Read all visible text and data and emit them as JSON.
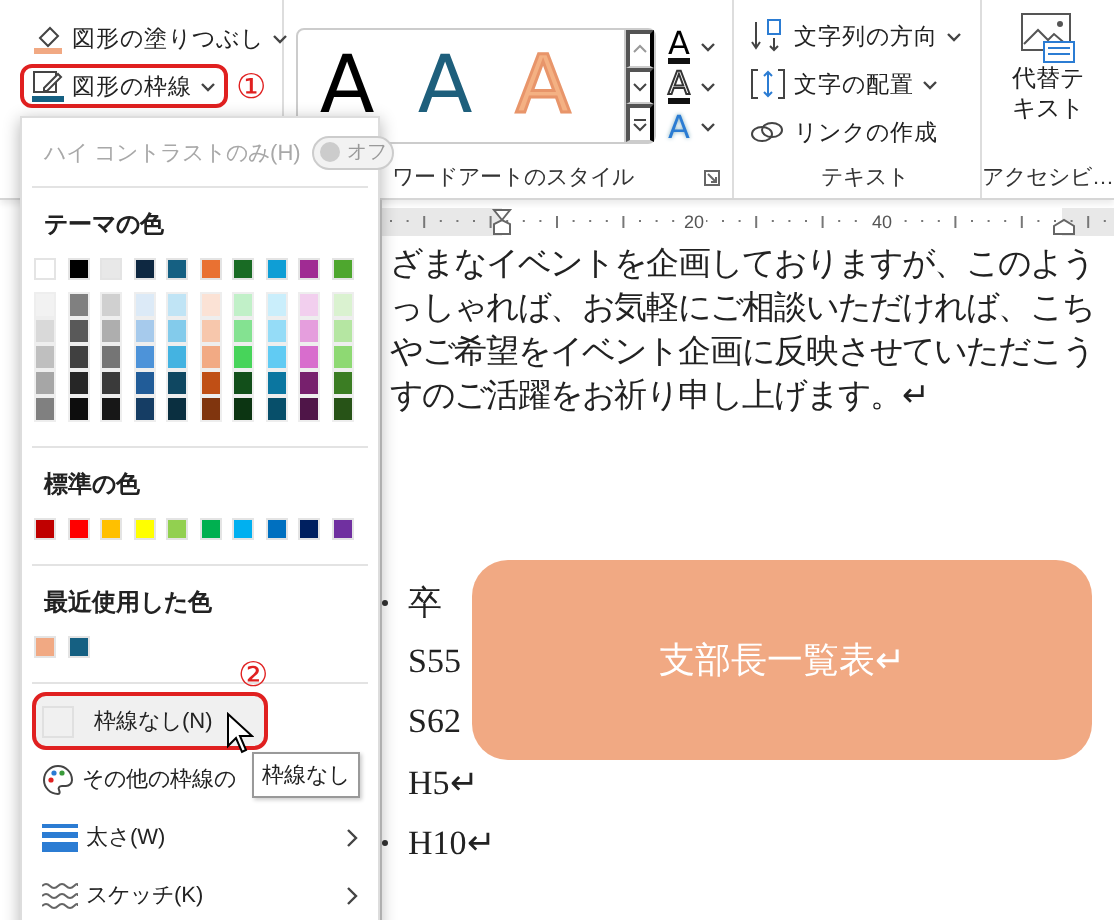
{
  "shape_group": {
    "callout": "①",
    "items": [
      {
        "label": "図形の塗りつぶし",
        "kind": "fill",
        "highlighted": false
      },
      {
        "label": "図形の枠線",
        "kind": "outline",
        "highlighted": true
      }
    ]
  },
  "wordart": {
    "label": "ワードアートのスタイル",
    "gallery": [
      {
        "glyph": "A",
        "kind": "fill",
        "color": "#000000"
      },
      {
        "glyph": "A",
        "kind": "fill",
        "color": "#1e5f7c"
      },
      {
        "glyph": "A",
        "kind": "outline",
        "color": "#f4b183"
      }
    ],
    "buttons": [
      {
        "glyph": "A",
        "kind": "fill"
      },
      {
        "glyph": "A",
        "kind": "outline"
      },
      {
        "glyph": "A",
        "kind": "effects"
      }
    ]
  },
  "text_group": {
    "label": "テキスト",
    "items": [
      {
        "label": "文字列の方向",
        "kind": "direction",
        "dropdown": true
      },
      {
        "label": "文字の配置",
        "kind": "align",
        "dropdown": true
      },
      {
        "label": "リンクの作成",
        "kind": "link",
        "dropdown": false
      }
    ]
  },
  "accessibility": {
    "label": "アクセシビ…",
    "button": "代替テキスト"
  },
  "ruler": {
    "ticks": [
      "20",
      "40"
    ]
  },
  "document": {
    "paragraph": [
      "ざまなイベントを企画しておりますが、このよう",
      "っしゃれば、お気軽にご相談いただければ、こち",
      "やご希望をイベント企画に反映させていただこう",
      "すのご活躍をお祈り申し上げます。↵"
    ],
    "list": [
      {
        "text": "卒",
        "bullet": true
      },
      {
        "text": "S55",
        "bullet": false
      },
      {
        "text": "S62",
        "bullet": false
      },
      {
        "text": "H5↵",
        "bullet": false
      },
      {
        "text": "H10↵",
        "bullet": true
      }
    ]
  },
  "shape": {
    "text": "支部長一覧表↵",
    "color": "#f1a983"
  },
  "outline_menu": {
    "toggle": {
      "label": "ハイ コントラストのみ(H)",
      "state": "オフ",
      "on": false,
      "disabled": true
    },
    "theme_title": "テーマの色",
    "theme": [
      {
        "color": "#ffffff",
        "shades": [
          {
            "color": "#f2f2f2"
          },
          {
            "color": "#d9d9d9"
          },
          {
            "color": "#bfbfbf"
          },
          {
            "color": "#a6a6a6"
          },
          {
            "color": "#808080"
          }
        ]
      },
      {
        "color": "#000000",
        "shades": [
          {
            "color": "#808080"
          },
          {
            "color": "#595959"
          },
          {
            "color": "#404040"
          },
          {
            "color": "#262626"
          },
          {
            "color": "#0d0d0d"
          }
        ]
      },
      {
        "color": "#e8e8e8",
        "shades": [
          {
            "color": "#d0d0d0"
          },
          {
            "color": "#aeaeae"
          },
          {
            "color": "#757575"
          },
          {
            "color": "#3a3a3a"
          },
          {
            "color": "#171717"
          }
        ]
      },
      {
        "color": "#0e2841",
        "shades": [
          {
            "color": "#dceaf7"
          },
          {
            "color": "#a6caec"
          },
          {
            "color": "#4d93d9"
          },
          {
            "color": "#215c98"
          },
          {
            "color": "#153d64"
          }
        ]
      },
      {
        "color": "#156082",
        "shades": [
          {
            "color": "#c0e4f5"
          },
          {
            "color": "#83cbeb"
          },
          {
            "color": "#44b3e1"
          },
          {
            "color": "#0f4761"
          },
          {
            "color": "#0a2f40"
          }
        ]
      },
      {
        "color": "#e97132",
        "shades": [
          {
            "color": "#fbe2d5"
          },
          {
            "color": "#f7c7ac"
          },
          {
            "color": "#f2aa84"
          },
          {
            "color": "#c04f15"
          },
          {
            "color": "#80350e"
          }
        ]
      },
      {
        "color": "#196b24",
        "shades": [
          {
            "color": "#c1f0c8"
          },
          {
            "color": "#84e291"
          },
          {
            "color": "#47d45a"
          },
          {
            "color": "#124f1a"
          },
          {
            "color": "#0c3512"
          }
        ]
      },
      {
        "color": "#0f9ed5",
        "shades": [
          {
            "color": "#caeefb"
          },
          {
            "color": "#95dcf7"
          },
          {
            "color": "#61cbf3"
          },
          {
            "color": "#0b76a0"
          },
          {
            "color": "#074f6a"
          }
        ]
      },
      {
        "color": "#a02b93",
        "shades": [
          {
            "color": "#f2cfee"
          },
          {
            "color": "#e59edd"
          },
          {
            "color": "#d86dcd"
          },
          {
            "color": "#77206d"
          },
          {
            "color": "#4f1548"
          }
        ]
      },
      {
        "color": "#4ea72e",
        "shades": [
          {
            "color": "#daf2d0"
          },
          {
            "color": "#b5e6a2"
          },
          {
            "color": "#8ed973"
          },
          {
            "color": "#3b7d23"
          },
          {
            "color": "#275317"
          }
        ]
      }
    ],
    "standard_title": "標準の色",
    "standard": [
      {
        "color": "#c00000"
      },
      {
        "color": "#ff0000"
      },
      {
        "color": "#ffc000"
      },
      {
        "color": "#ffff00"
      },
      {
        "color": "#92d050"
      },
      {
        "color": "#00b050"
      },
      {
        "color": "#00b0f0"
      },
      {
        "color": "#0070c0"
      },
      {
        "color": "#002060"
      },
      {
        "color": "#7030a0"
      }
    ],
    "recent_title": "最近使用した色",
    "recent": [
      {
        "color": "#f1a983"
      },
      {
        "color": "#156082"
      }
    ],
    "callout": "②",
    "items": [
      {
        "label": "枠線なし(N)",
        "kind": "none",
        "highlighted": true
      },
      {
        "label": "その他の枠線の",
        "kind": "more",
        "highlighted": false
      },
      {
        "label": "太さ(W)",
        "kind": "weight",
        "highlighted": false,
        "submenu": true
      },
      {
        "label": "スケッチ(K)",
        "kind": "sketch",
        "highlighted": false,
        "submenu": true
      }
    ]
  },
  "tooltip": "枠線なし"
}
